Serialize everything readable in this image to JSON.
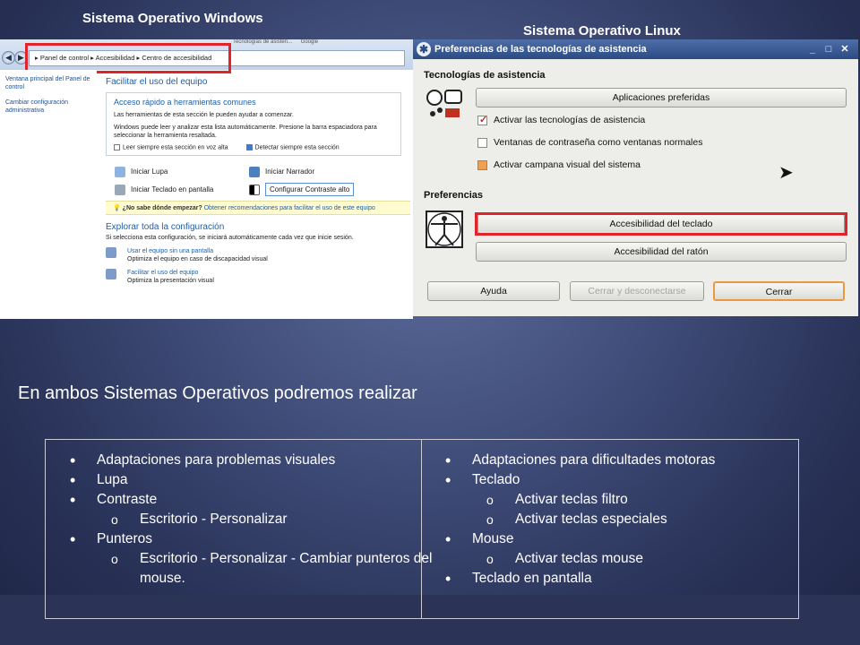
{
  "captions": {
    "windows": "Sistema Operativo Windows",
    "linux": "Sistema Operativo Linux"
  },
  "windows": {
    "tabs": [
      "Tecnologías de asisten...",
      "Google"
    ],
    "address": [
      "Panel de control",
      "Accesibilidad",
      "Centro de accesibilidad"
    ],
    "sidebar": [
      "Ventana principal del Panel de control",
      "Cambiar configuración administrativa"
    ],
    "heading": "Facilitar el uso del equipo",
    "quick_title": "Acceso rápido a herramientas comunes",
    "quick_text1": "Las herramientas de esta sección le pueden ayudar a comenzar.",
    "quick_text2": "Windows puede leer y analizar esta lista automáticamente. Presione la barra espaciadora para seleccionar la herramienta resaltada.",
    "check_read": "Leer siempre esta sección en voz alta",
    "check_detect": "Detectar siempre esta sección",
    "tool_lupa": "Iniciar Lupa",
    "tool_narrador": "Iniciar Narrador",
    "tool_teclado": "Iniciar Teclado en pantalla",
    "tool_contraste": "Configurar Contraste alto",
    "hint_q": "¿No sabe dónde empezar?",
    "hint_link": "Obtener recomendaciones para facilitar el uso de este equipo",
    "explore_title": "Explorar toda la configuración",
    "explore_text": "Si selecciona esta configuración, se iniciará automáticamente cada vez que inicie sesión.",
    "item1_link": "Usar el equipo sin una pantalla",
    "item1_text": "Optimiza el equipo en caso de discapacidad visual",
    "item2_link": "Facilitar el uso del equipo",
    "item2_text": "Optimiza la presentación visual"
  },
  "linux": {
    "title": "Preferencias de las tecnologías de asistencia",
    "section1": "Tecnologías de asistencia",
    "btn_preferred": "Aplicaciones preferidas",
    "chk_activate": "Activar las tecnologías de asistencia",
    "chk_password": "Ventanas de contraseña como ventanas normales",
    "chk_bell": "Activar campana visual del sistema",
    "section2": "Preferencias",
    "btn_keyboard": "Accesibilidad del teclado",
    "btn_mouse": "Accesibilidad del ratón",
    "btn_help": "Ayuda",
    "btn_logout": "Cerrar y desconectarse",
    "btn_close": "Cerrar"
  },
  "heading": "En ambos Sistemas Operativos podremos realizar",
  "left_col": {
    "i1": "Adaptaciones para problemas visuales",
    "i2": "Lupa",
    "i3": "Contraste",
    "i3s1": "Escritorio - Personalizar",
    "i4": "Punteros",
    "i4s1": "Escritorio - Personalizar - Cambiar punteros del mouse."
  },
  "right_col": {
    "i1": "Adaptaciones para dificultades motoras",
    "i2": "Teclado",
    "i2s1": "Activar teclas filtro",
    "i2s2": "Activar teclas especiales",
    "i3": "Mouse",
    "i3s1": "Activar teclas mouse",
    "i4": "Teclado en pantalla"
  }
}
